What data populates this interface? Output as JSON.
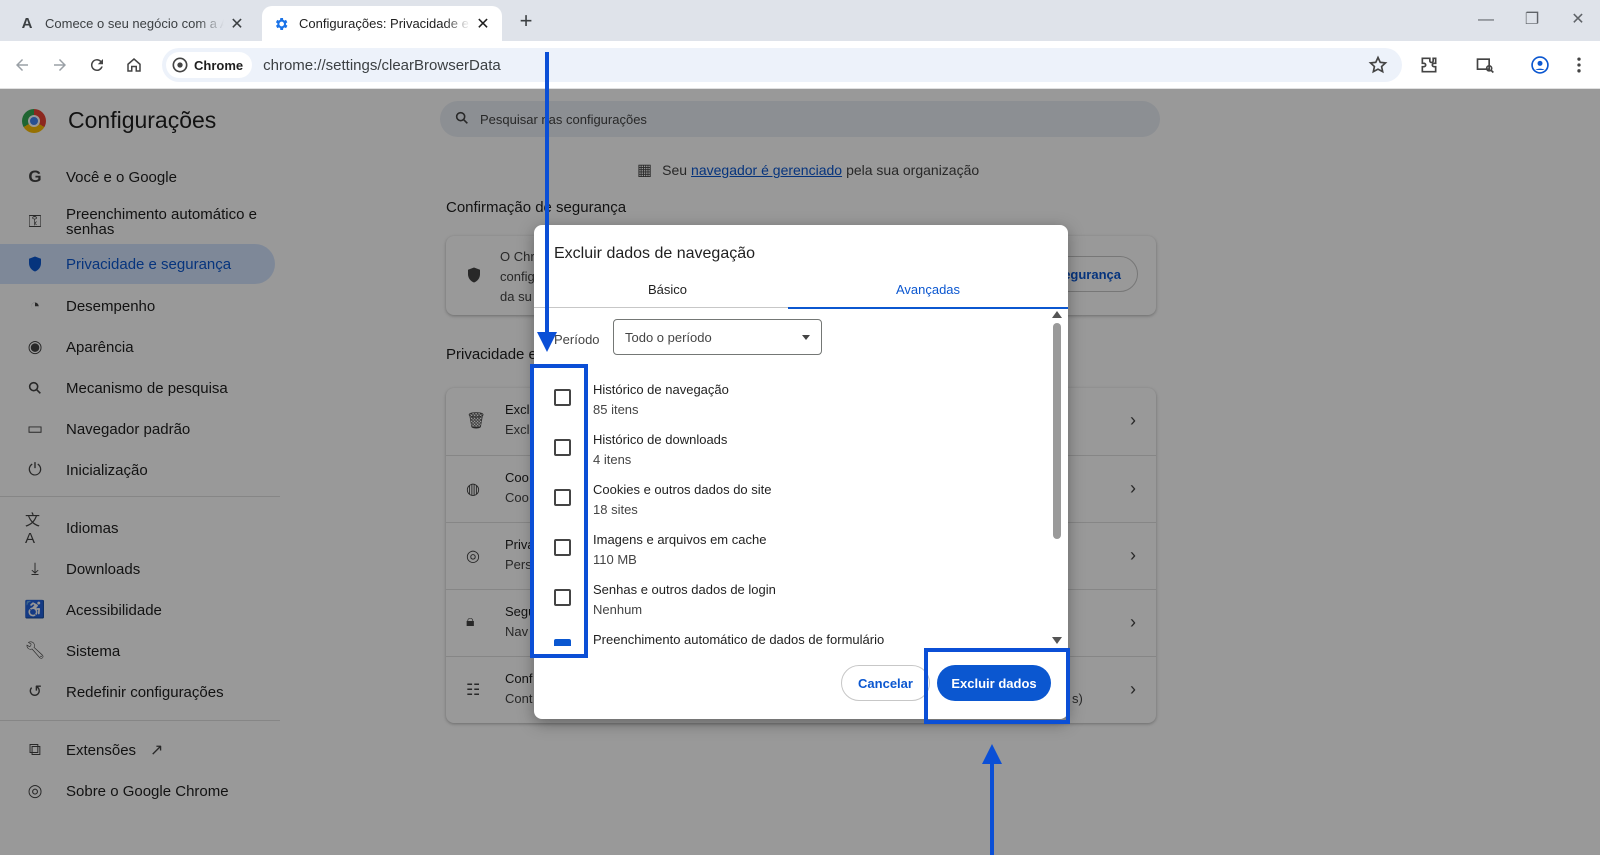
{
  "browser": {
    "tabs": [
      {
        "title": "Comece o seu negócio com a A",
        "favicon": "A",
        "active": false
      },
      {
        "title": "Configurações: Privacidade e se",
        "favicon": "gear-icon",
        "active": true
      }
    ],
    "chip_label": "Chrome",
    "url": "chrome://settings/clearBrowserData"
  },
  "settings": {
    "title": "Configurações",
    "search_placeholder": "Pesquisar nas configurações",
    "managed": {
      "prefix": "Seu",
      "link": "navegador é gerenciado",
      "suffix": "pela sua organização"
    },
    "nav": [
      {
        "label": "Você e o Google",
        "icon": "google-g-icon"
      },
      {
        "label": "Preenchimento automático e senhas",
        "icon": "key-icon"
      },
      {
        "label": "Privacidade e segurança",
        "icon": "shield-icon",
        "selected": true
      },
      {
        "label": "Desempenho",
        "icon": "speedometer-icon"
      },
      {
        "label": "Aparência",
        "icon": "palette-icon"
      },
      {
        "label": "Mecanismo de pesquisa",
        "icon": "search-icon"
      },
      {
        "label": "Navegador padrão",
        "icon": "browser-window-icon"
      },
      {
        "label": "Inicialização",
        "icon": "power-icon"
      },
      {
        "label": "Idiomas",
        "icon": "translate-icon"
      },
      {
        "label": "Downloads",
        "icon": "download-icon"
      },
      {
        "label": "Acessibilidade",
        "icon": "accessibility-icon"
      },
      {
        "label": "Sistema",
        "icon": "wrench-icon"
      },
      {
        "label": "Redefinir configurações",
        "icon": "reset-icon"
      },
      {
        "label": "Extensões",
        "icon": "puzzle-icon"
      },
      {
        "label": "Sobre o Google Chrome",
        "icon": "chrome-icon"
      }
    ],
    "safety_title": "Confirmação de segurança",
    "safety_text": [
      "O Chr",
      "config",
      "da su"
    ],
    "safety_button": "egurança",
    "privacy_title": "Privacidade e",
    "privacy_rows": [
      {
        "title": "Exclu",
        "sub": "Exclu",
        "icon": "trash-icon"
      },
      {
        "title": "Coo",
        "sub": "Coo",
        "icon": "cookie-icon"
      },
      {
        "title": "Priva",
        "sub": "Pers",
        "icon": "privacy-sandbox-icon"
      },
      {
        "title": "Segu",
        "sub": "Nav",
        "icon": "lock-icon"
      },
      {
        "title": "Conf",
        "sub": "Cont",
        "extra": "s)",
        "icon": "tune-icon"
      }
    ]
  },
  "dialog": {
    "title": "Excluir dados de navegação",
    "tab_basic": "Básico",
    "tab_advanced": "Avançadas",
    "period_label": "Período",
    "period_value": "Todo o período",
    "items": [
      {
        "title": "Histórico de navegação",
        "sub": "85 itens",
        "checked": false
      },
      {
        "title": "Histórico de downloads",
        "sub": "4 itens",
        "checked": false
      },
      {
        "title": "Cookies e outros dados do site",
        "sub": "18 sites",
        "checked": false
      },
      {
        "title": "Imagens e arquivos em cache",
        "sub": "110 MB",
        "checked": false
      },
      {
        "title": "Senhas e outros dados de login",
        "sub": "Nenhum",
        "checked": false
      },
      {
        "title": "Preenchimento automático de dados de formulário",
        "sub": "",
        "checked": true
      }
    ],
    "cancel": "Cancelar",
    "confirm": "Excluir dados"
  },
  "colors": {
    "accent": "#0b57d0",
    "annotation": "#0b4fd6",
    "selected_nav_bg": "#d3e3fd"
  }
}
